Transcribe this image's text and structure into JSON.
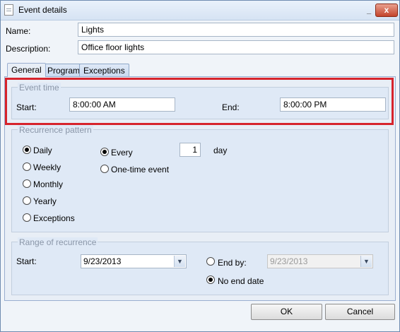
{
  "window": {
    "title": "Event details",
    "minimize_glyph": "_",
    "close_glyph": "x"
  },
  "fields": {
    "name_label": "Name:",
    "name_value": "Lights",
    "description_label": "Description:",
    "description_value": "Office floor lights"
  },
  "tabs": [
    {
      "label": "General",
      "active": true
    },
    {
      "label": "Program",
      "active": false
    },
    {
      "label": "Exceptions",
      "active": false
    }
  ],
  "event_time": {
    "legend": "Event time",
    "start_label": "Start:",
    "start_value": "8:00:00 AM",
    "end_label": "End:",
    "end_value": "8:00:00 PM",
    "highlight_color": "#d7242c"
  },
  "recurrence": {
    "legend": "Recurrence pattern",
    "options": [
      "Daily",
      "Weekly",
      "Monthly",
      "Yearly",
      "Exceptions"
    ],
    "selected": "Daily",
    "every_label": "Every",
    "every_value": "1",
    "unit_label": "day",
    "onetime_label": "One-time event",
    "every_selected": true
  },
  "range": {
    "legend": "Range of recurrence",
    "start_label": "Start:",
    "start_value": "9/23/2013",
    "end_by_label": "End by:",
    "end_by_value": "9/23/2013",
    "no_end_label": "No end date",
    "no_end_selected": true
  },
  "buttons": {
    "ok": "OK",
    "cancel": "Cancel"
  },
  "icons": {
    "dropdown": "chevron-down-icon",
    "doc": "document-icon"
  }
}
